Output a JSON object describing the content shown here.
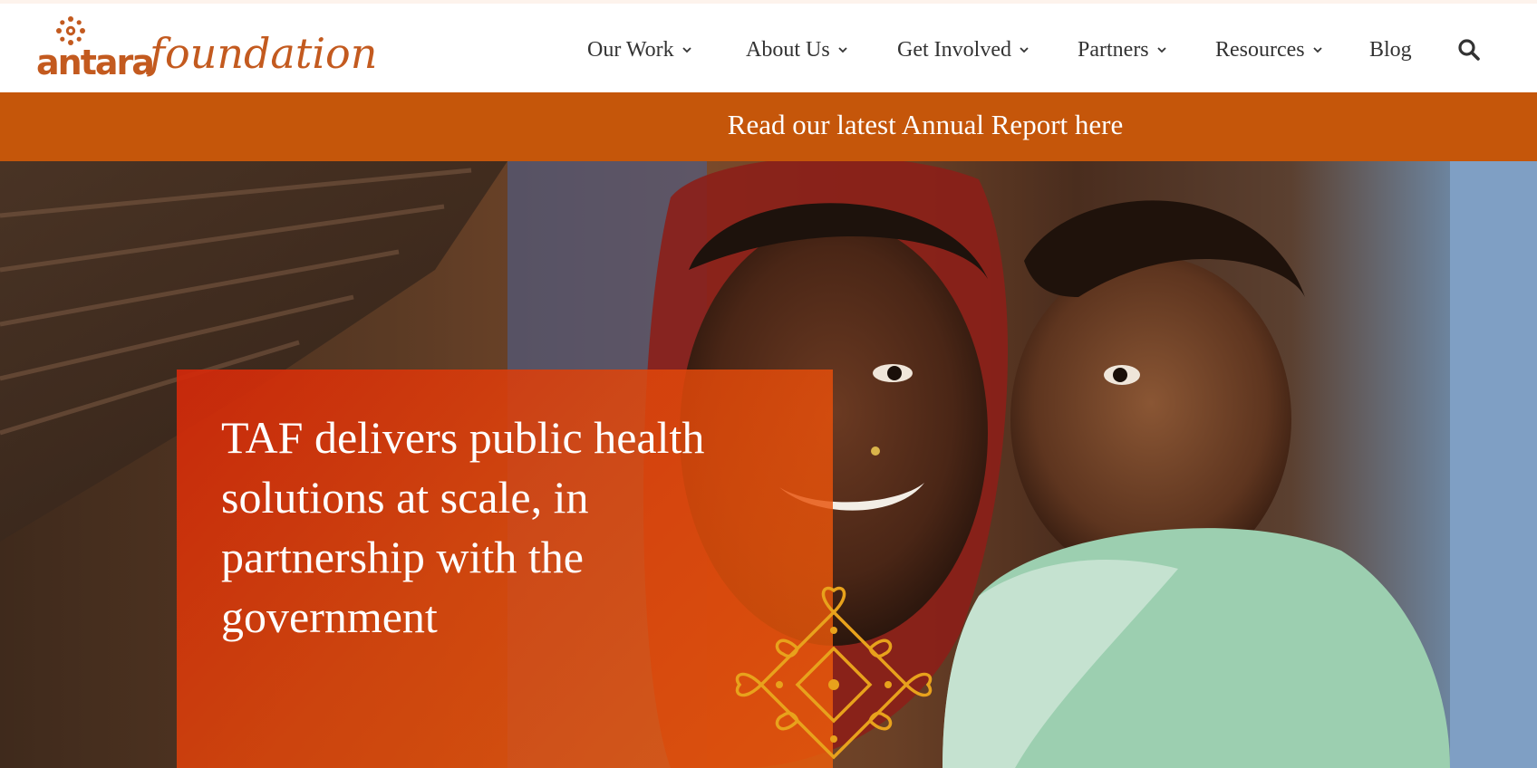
{
  "logo": {
    "part_a": "antara",
    "part_b": "foundation",
    "color": "#c35a1f"
  },
  "nav": {
    "items": [
      {
        "label": "Our Work",
        "has_dropdown": true
      },
      {
        "label": "About Us",
        "has_dropdown": true
      },
      {
        "label": "Get Involved",
        "has_dropdown": true
      },
      {
        "label": "Partners",
        "has_dropdown": true
      },
      {
        "label": "Resources",
        "has_dropdown": true
      },
      {
        "label": "Blog",
        "has_dropdown": false
      }
    ],
    "search_icon": "search-icon"
  },
  "banner": {
    "text": "Read our latest Annual Report here",
    "color": "#c5560a"
  },
  "hero": {
    "title": "TAF delivers public health solutions at scale, in partnership with the government",
    "overlay_color": "#d9380c",
    "motif_color": "#e8a21c"
  }
}
